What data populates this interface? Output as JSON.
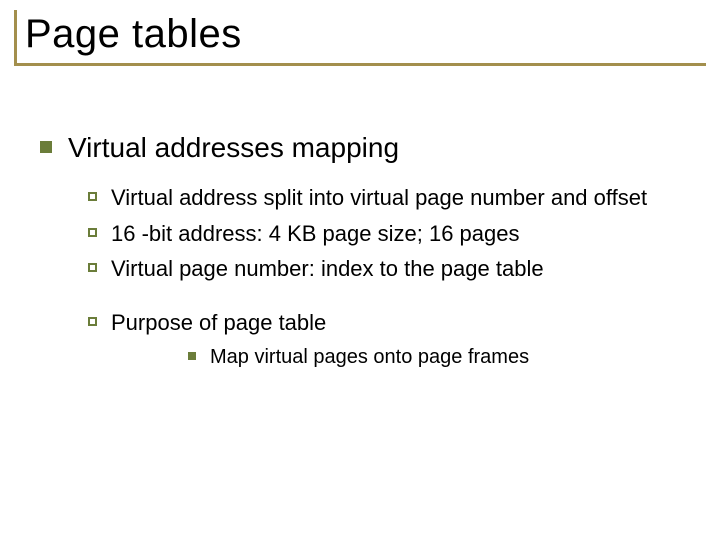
{
  "title": "Page tables",
  "lvl1": {
    "text": "Virtual addresses mapping"
  },
  "lvl2_group_a": [
    "Virtual address split into virtual page number and offset",
    "16 -bit address: 4 KB page size; 16 pages",
    "Virtual page number: index to the page table"
  ],
  "lvl2_group_b": [
    "Purpose of page table"
  ],
  "lvl3_group": [
    "Map virtual pages onto page frames"
  ]
}
